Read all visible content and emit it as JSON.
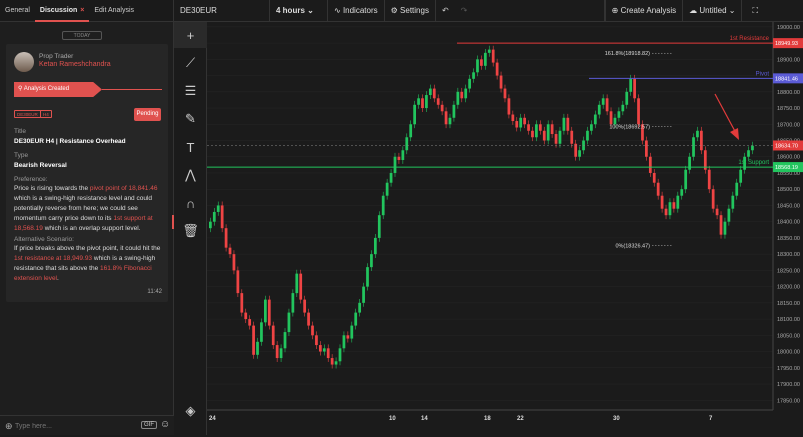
{
  "tabs": {
    "general": "General",
    "discussion": "Discussion",
    "edit": "Edit Analysis"
  },
  "today": "TODAY",
  "author": {
    "role": "Prop Trader",
    "name": "Ketan Rameshchandra"
  },
  "status": {
    "created": "Analysis Created",
    "symbol_badge": "DE30EUR",
    "tf_badge": "H4",
    "pending": "Pending"
  },
  "fields": {
    "title_label": "Title",
    "title": "DE30EUR H4 | Resistance Overhead",
    "type_label": "Type",
    "type": "Bearish Reversal",
    "pref_label": "Preference:",
    "alt_label": "Alternative Scenario:"
  },
  "pref": {
    "a": "Price is rising towards the ",
    "b": "pivot point of 18,841.46",
    "c": " which is a swing-high resistance level and could potentially reverse from here; we could see momentum carry price down to its ",
    "d": "1st support at 18,568.19",
    "e": " which is an overlap support level."
  },
  "alt": {
    "a": "If price breaks above the pivot point, it could hit the ",
    "b": "1st resistance at 18,949.93",
    "c": " which is a swing-high resistance that sits above the ",
    "d": "161.8% Fibonacci extension level",
    "e": "."
  },
  "time": "11:42",
  "input": {
    "placeholder": "Type here...",
    "gif": "GIF"
  },
  "toolbar": {
    "symbol": "DE30EUR",
    "timeframe": "4 hours",
    "indicators": "Indicators",
    "settings": "Settings",
    "create": "Create Analysis",
    "untitled": "Untitled"
  },
  "chart_data": {
    "type": "candlestick",
    "symbol": "DE30EUR",
    "timeframe": "4 hours",
    "y_ticks": [
      19000,
      18950,
      18900,
      18850,
      18800,
      18750,
      18700,
      18650,
      18600,
      18550,
      18500,
      18450,
      18400,
      18350,
      18300,
      18250,
      18200,
      18150,
      18100,
      18050,
      18000,
      17950,
      17900,
      17850
    ],
    "y_tick_labels": [
      "19000.00",
      "18950.00",
      "18900.00",
      "18850.00",
      "18800.00",
      "18750.00",
      "18700.00",
      "18650.00",
      "18600.00",
      "18550.00",
      "18500.00",
      "18450.00",
      "18400.00",
      "18350.00",
      "18300.00",
      "18250.00",
      "18200.00",
      "18150.00",
      "18100.00",
      "18050.00",
      "18000.00",
      "17950.00",
      "17900.00",
      "17850.00"
    ],
    "ylim": [
      17820,
      19015
    ],
    "x_labels": [
      "24",
      "10",
      "14",
      "18",
      "22",
      "30",
      "7"
    ],
    "levels": [
      {
        "name": "1st Resistance",
        "value": 18949.93,
        "label": "18949.93",
        "color": "#e23b3b"
      },
      {
        "name": "Pivot",
        "value": 18841.46,
        "label": "18841.46",
        "color": "#5b5bd6"
      },
      {
        "name": "1st Support",
        "value": 18568.19,
        "label": "18568.19",
        "color": "#22c55e"
      }
    ],
    "last_price": {
      "value": 18634.7,
      "label": "18634.70",
      "color": "#e23b3b"
    },
    "fib": [
      {
        "label": "161.8%(18918.82)"
      },
      {
        "label": "100%(18692.57)"
      },
      {
        "label": "0%(18326.47)"
      }
    ],
    "closes": [
      18400,
      18430,
      18450,
      18380,
      18320,
      18300,
      18250,
      18180,
      18120,
      18100,
      18080,
      17990,
      18030,
      18090,
      18160,
      18080,
      18020,
      17980,
      18010,
      18060,
      18120,
      18180,
      18240,
      18160,
      18120,
      18080,
      18050,
      18020,
      18000,
      18010,
      17980,
      17960,
      17970,
      18010,
      18050,
      18040,
      18080,
      18120,
      18150,
      18200,
      18260,
      18300,
      18350,
      18420,
      18480,
      18520,
      18550,
      18600,
      18590,
      18620,
      18660,
      18700,
      18760,
      18780,
      18750,
      18790,
      18810,
      18780,
      18760,
      18740,
      18700,
      18720,
      18760,
      18800,
      18780,
      18810,
      18840,
      18860,
      18900,
      18880,
      18920,
      18930,
      18890,
      18850,
      18810,
      18780,
      18730,
      18710,
      18690,
      18720,
      18700,
      18680,
      18660,
      18700,
      18680,
      18650,
      18700,
      18670,
      18640,
      18680,
      18720,
      18680,
      18640,
      18600,
      18620,
      18650,
      18680,
      18700,
      18730,
      18760,
      18780,
      18740,
      18700,
      18720,
      18740,
      18760,
      18800,
      18840,
      18780,
      18700,
      18650,
      18600,
      18550,
      18520,
      18480,
      18440,
      18420,
      18460,
      18440,
      18480,
      18500,
      18560,
      18600,
      18660,
      18680,
      18620,
      18560,
      18500,
      18440,
      18420,
      18360,
      18400,
      18440,
      18480,
      18520,
      18560,
      18600,
      18620,
      18634
    ]
  }
}
